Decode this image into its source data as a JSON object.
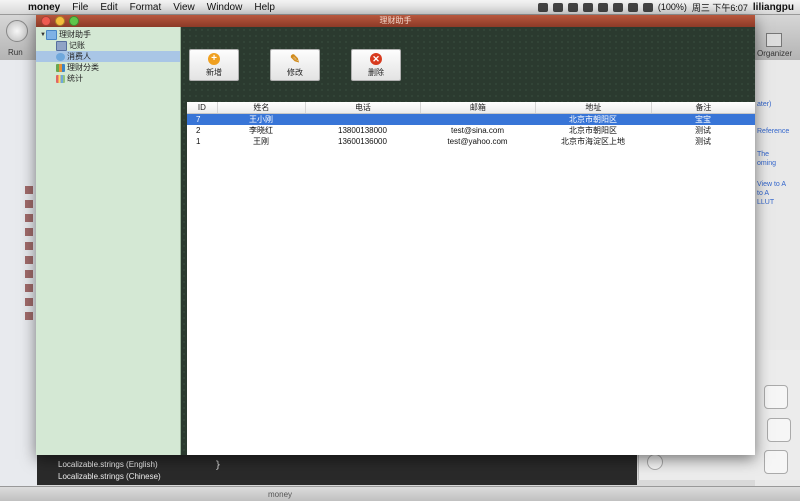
{
  "menubar": {
    "app_name": "money",
    "items": [
      "File",
      "Edit",
      "Format",
      "View",
      "Window",
      "Help"
    ],
    "battery": "(100%)",
    "clock": "周三 下午6:07",
    "user": "liliangpu"
  },
  "xcode": {
    "run_label": "Run",
    "organizer_label": "Organizer",
    "files": [
      "Localizable.strings (English)",
      "Localizable.strings (Chinese)"
    ],
    "status": "money",
    "right_snippets": [
      "ater)",
      "Reference",
      "The",
      "oming",
      "View to A",
      "to A",
      "LLUT"
    ],
    "code_brace": "}"
  },
  "window": {
    "title": "理财助手"
  },
  "sidebar": {
    "root": "理财助手",
    "items": [
      {
        "label": "记账",
        "icon": "book-icon"
      },
      {
        "label": "消费人",
        "icon": "person-icon"
      },
      {
        "label": "理财分类",
        "icon": "category-icon"
      },
      {
        "label": "统计",
        "icon": "stats-icon"
      }
    ]
  },
  "toolbar": {
    "add_label": "新增",
    "edit_label": "修改",
    "delete_label": "删除"
  },
  "table": {
    "columns": [
      "ID",
      "姓名",
      "电话",
      "邮箱",
      "地址",
      "备注"
    ],
    "rows": [
      {
        "id": "7",
        "name": "王小刚",
        "phone": "",
        "email": "",
        "address": "北京市朝阳区",
        "note": "宝宝",
        "selected": true
      },
      {
        "id": "2",
        "name": "李晓红",
        "phone": "13800138000",
        "email": "test@sina.com",
        "address": "北京市朝阳区",
        "note": "测试"
      },
      {
        "id": "1",
        "name": "王刚",
        "phone": "13600136000",
        "email": "test@yahoo.com",
        "address": "北京市海淀区上地",
        "note": "测试"
      }
    ]
  }
}
